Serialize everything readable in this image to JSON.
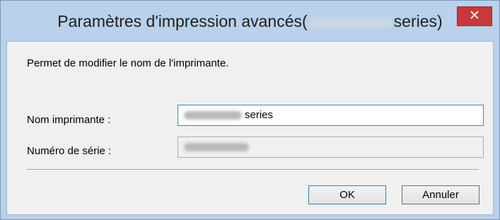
{
  "window": {
    "title_prefix": "Paramètres d'impression avancés(",
    "title_suffix": "series)",
    "close_glyph": "✕"
  },
  "dialog": {
    "description": "Permet de modifier le nom de l'imprimante.",
    "printer_name_label": "Nom imprimante :",
    "printer_name_value": "series",
    "serial_label": "Numéro de série :"
  },
  "buttons": {
    "ok": "OK",
    "cancel": "Annuler"
  },
  "icons": {
    "close": "close-icon"
  },
  "colors": {
    "titlebar": "#b9d1ea",
    "close_button": "#c7393a",
    "client_background": "#f0f0f0"
  }
}
